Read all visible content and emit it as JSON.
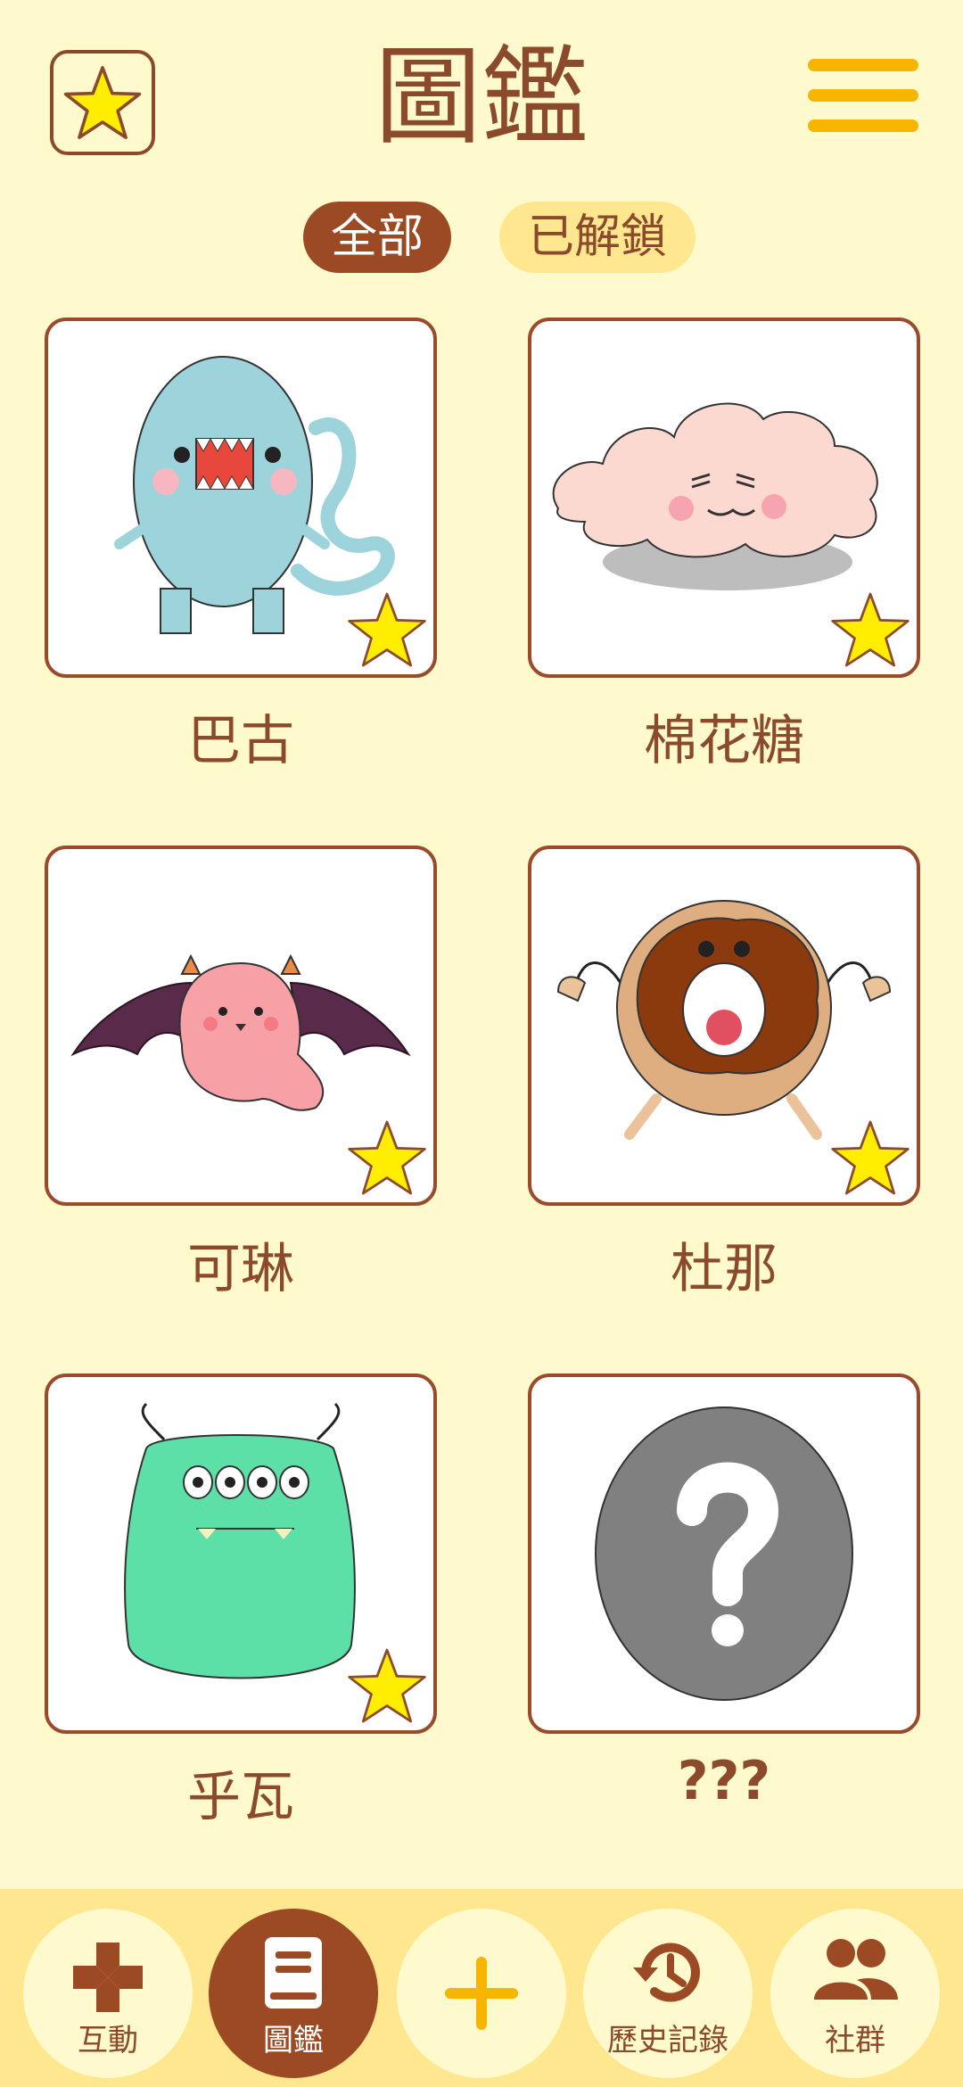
{
  "header": {
    "title": "圖鑑",
    "star_icon": "star-icon",
    "menu_icon": "hamburger-menu-icon"
  },
  "tabs": [
    {
      "label": "全部",
      "active": true
    },
    {
      "label": "已解鎖",
      "active": false
    }
  ],
  "monsters": [
    {
      "name": "巴古",
      "art": "blue-monster",
      "unlocked": true
    },
    {
      "name": "棉花糖",
      "art": "cloud-monster",
      "unlocked": true
    },
    {
      "name": "可琳",
      "art": "bat-ghost-monster",
      "unlocked": true
    },
    {
      "name": "杜那",
      "art": "donut-monster",
      "unlocked": true
    },
    {
      "name": "乎瓦",
      "art": "green-fuzzy-monster",
      "unlocked": true
    },
    {
      "name": "???",
      "art": "locked-question-mark",
      "unlocked": false
    }
  ],
  "bottom_nav": [
    {
      "label": "互動",
      "icon": "gamepad-cross-icon",
      "active": false
    },
    {
      "label": "圖鑑",
      "icon": "book-icon",
      "active": true
    },
    {
      "label": "",
      "icon": "plus-icon",
      "active": false
    },
    {
      "label": "歷史記錄",
      "icon": "history-icon",
      "active": false
    },
    {
      "label": "社群",
      "icon": "people-icon",
      "active": false
    }
  ],
  "colors": {
    "background": "#FFFACD",
    "brown": "#8B4A2B",
    "accent_yellow": "#F7B500",
    "tab_inactive": "#FFE78F",
    "star": "#FFEE00"
  }
}
